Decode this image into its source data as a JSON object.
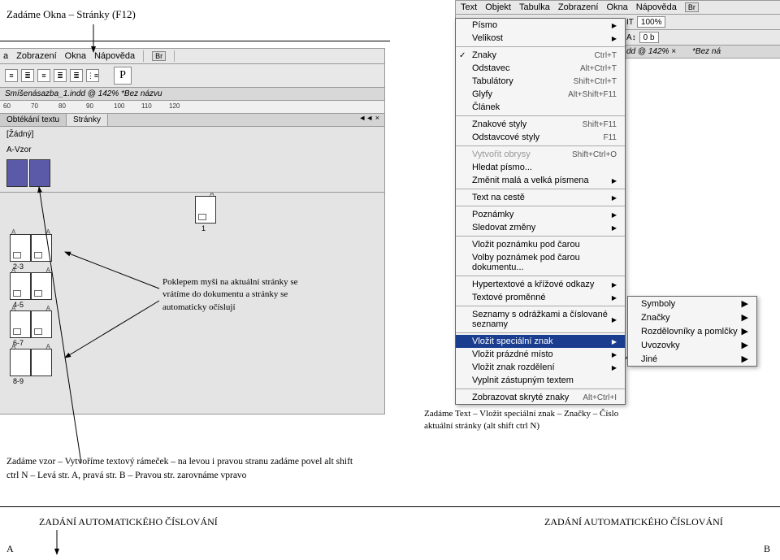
{
  "left": {
    "title": "Zadáme Okna – Stránky (F12)",
    "menubar": {
      "items": [
        "a",
        "Zobrazení",
        "Okna",
        "Nápověda"
      ],
      "br": "Br"
    },
    "toolbar": {
      "p_label": "P"
    },
    "docbar": "Smíšenásazba_1.indd @ 142%        *Bez názvu",
    "ruler_ticks": [
      "60",
      "70",
      "80",
      "90",
      "100",
      "110",
      "120"
    ],
    "panel": {
      "tabs": [
        "Obtékání textu",
        "Stránky"
      ],
      "collapse": "◄◄  ×",
      "master_none": "[Žádný]",
      "master_a": "A-Vzor",
      "page_ranges": [
        "1",
        "2-3",
        "4-5",
        "6-7",
        "8-9"
      ]
    }
  },
  "right": {
    "menubar": {
      "items": [
        "Text",
        "Objekt",
        "Tabulka",
        "Zobrazení",
        "Okna",
        "Nápověda"
      ],
      "br": "Br"
    },
    "toolbar2": {
      "it": "IT",
      "pct": "100%",
      "aa": "A↕",
      "val": "0 b"
    },
    "docbar2": {
      "a": "dd @ 142%  ×",
      "b": "*Bez ná"
    }
  },
  "menu": {
    "items": [
      {
        "label": "Písmo",
        "sub": true
      },
      {
        "label": "Velikost",
        "sub": true
      },
      {
        "sep": true
      },
      {
        "label": "Znaky",
        "sc": "Ctrl+T",
        "check": true
      },
      {
        "label": "Odstavec",
        "sc": "Alt+Ctrl+T"
      },
      {
        "label": "Tabulátory",
        "sc": "Shift+Ctrl+T"
      },
      {
        "label": "Glyfy",
        "sc": "Alt+Shift+F11"
      },
      {
        "label": "Článek"
      },
      {
        "sep": true
      },
      {
        "label": "Znakové styly",
        "sc": "Shift+F11"
      },
      {
        "label": "Odstavcové styly",
        "sc": "F11"
      },
      {
        "sep": true
      },
      {
        "label": "Vytvořit obrysy",
        "sc": "Shift+Ctrl+O",
        "disabled": true
      },
      {
        "label": "Hledat písmo..."
      },
      {
        "label": "Změnit malá a velká písmena",
        "sub": true
      },
      {
        "sep": true
      },
      {
        "label": "Text na cestě",
        "sub": true
      },
      {
        "sep": true
      },
      {
        "label": "Poznámky",
        "sub": true
      },
      {
        "label": "Sledovat změny",
        "sub": true
      },
      {
        "sep": true
      },
      {
        "label": "Vložit poznámku pod čarou"
      },
      {
        "label": "Volby poznámek pod čarou dokumentu..."
      },
      {
        "sep": true
      },
      {
        "label": "Hypertextové a křížové odkazy",
        "sub": true
      },
      {
        "label": "Textové proměnné",
        "sub": true
      },
      {
        "sep": true
      },
      {
        "label": "Seznamy s odrážkami a číslované seznamy",
        "sub": true
      },
      {
        "sep": true
      },
      {
        "label": "Vložit speciální znak",
        "sub": true,
        "highlighted": true
      },
      {
        "label": "Vložit prázdné místo",
        "sub": true
      },
      {
        "label": "Vložit znak rozdělení",
        "sub": true
      },
      {
        "label": "Vyplnit zástupným textem"
      },
      {
        "sep": true
      },
      {
        "label": "Zobrazovat skryté znaky",
        "sc": "Alt+Ctrl+I"
      }
    ]
  },
  "submenu": {
    "items": [
      {
        "label": "Symboly",
        "sub": true
      },
      {
        "label": "Značky",
        "sub": true
      },
      {
        "label": "Rozdělovníky a pomlčky",
        "sub": true
      },
      {
        "label": "Uvozovky",
        "sub": true
      },
      {
        "label": "Jiné",
        "sub": true
      }
    ]
  },
  "callouts": {
    "c1": "Poklepem myši na aktuální stránky se vrátíme do dokumentu a stránky se automaticky očíslují",
    "c2": "Zadáme Text – Vložit speciální znak – Značky – Číslo aktuální stránky (alt shift ctrl N)"
  },
  "instruction": "Zadáme vzor – Vytvoříme textový rámeček – na levou i pravou stranu zadáme povel alt shift ctrl  N – Levá str. A, pravá str. B – Pravou str. zarovnáme vpravo",
  "bottom": {
    "left": "ZADÁNÍ AUTOMATICKÉHO ČÍSLOVÁNÍ",
    "right": "ZADÁNÍ AUTOMATICKÉHO ČÍSLOVÁNÍ",
    "a": "A",
    "b": "B"
  }
}
